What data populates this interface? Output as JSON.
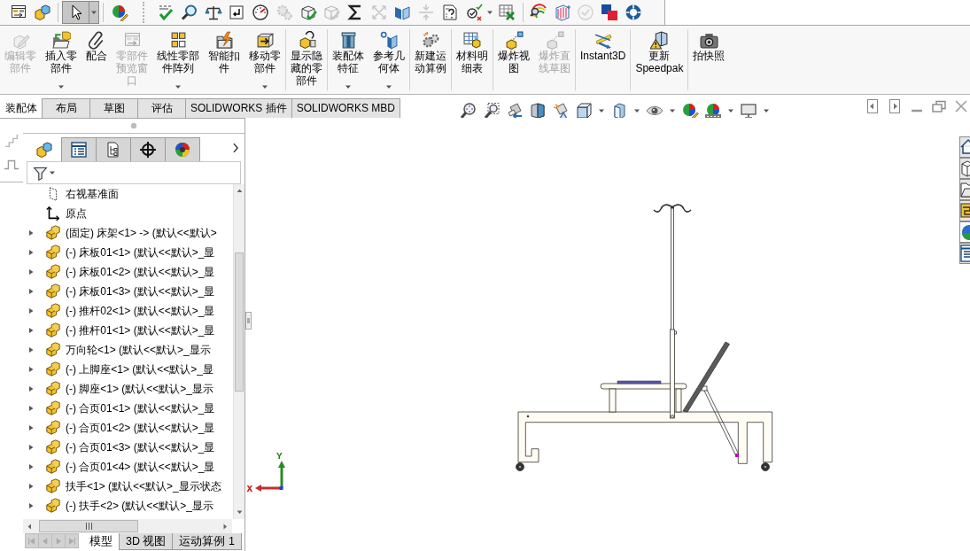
{
  "quick_access_toolbar": [
    {
      "kind": "button",
      "disabled": false
    },
    {
      "kind": "button",
      "disabled": false
    },
    {
      "kind": "separator"
    },
    {
      "kind": "split",
      "pressed": true
    },
    {
      "kind": "separator"
    },
    {
      "kind": "button",
      "disabled": false
    },
    {
      "kind": "grip"
    },
    {
      "kind": "button",
      "disabled": false
    },
    {
      "kind": "button",
      "disabled": false
    },
    {
      "kind": "button",
      "disabled": false
    },
    {
      "kind": "button",
      "disabled": false
    },
    {
      "kind": "button",
      "disabled": false
    },
    {
      "kind": "button",
      "disabled": true
    },
    {
      "kind": "button",
      "disabled": false
    },
    {
      "kind": "button",
      "disabled": true
    },
    {
      "kind": "button",
      "disabled": false
    },
    {
      "kind": "button",
      "disabled": true
    },
    {
      "kind": "button",
      "disabled": false
    },
    {
      "kind": "button",
      "disabled": true
    },
    {
      "kind": "button",
      "disabled": false
    },
    {
      "kind": "split",
      "pressed": false
    },
    {
      "kind": "button",
      "disabled": false
    },
    {
      "kind": "separator"
    },
    {
      "kind": "button",
      "disabled": false
    },
    {
      "kind": "button",
      "disabled": false
    },
    {
      "kind": "button",
      "disabled": true
    },
    {
      "kind": "button",
      "disabled": false
    },
    {
      "kind": "button",
      "disabled": false
    }
  ],
  "command_manager": [
    {
      "kind": "button",
      "label_lines": [
        "编辑零",
        "部件"
      ],
      "disabled": true,
      "dropdown": false
    },
    {
      "kind": "button",
      "label_lines": [
        "插入零",
        "部件"
      ],
      "disabled": false,
      "dropdown": true
    },
    {
      "kind": "button",
      "label_lines": [
        "配合"
      ],
      "disabled": false,
      "dropdown": false
    },
    {
      "kind": "button",
      "label_lines": [
        "零部件",
        "预览窗",
        "口"
      ],
      "disabled": true,
      "dropdown": false
    },
    {
      "kind": "button",
      "label_lines": [
        "线性零部",
        "件阵列"
      ],
      "disabled": false,
      "dropdown": true
    },
    {
      "kind": "button",
      "label_lines": [
        "智能扣",
        "件"
      ],
      "disabled": false,
      "dropdown": false
    },
    {
      "kind": "button",
      "label_lines": [
        "移动零",
        "部件"
      ],
      "disabled": false,
      "dropdown": true
    },
    {
      "kind": "separator"
    },
    {
      "kind": "button",
      "label_lines": [
        "显示隐",
        "藏的零",
        "部件"
      ],
      "disabled": false,
      "dropdown": false
    },
    {
      "kind": "separator"
    },
    {
      "kind": "button",
      "label_lines": [
        "装配体",
        "特征"
      ],
      "disabled": false,
      "dropdown": true
    },
    {
      "kind": "button",
      "label_lines": [
        "参考几",
        "何体"
      ],
      "disabled": false,
      "dropdown": true
    },
    {
      "kind": "separator"
    },
    {
      "kind": "button",
      "label_lines": [
        "新建运",
        "动算例"
      ],
      "disabled": false,
      "dropdown": false
    },
    {
      "kind": "separator"
    },
    {
      "kind": "button",
      "label_lines": [
        "材料明",
        "细表"
      ],
      "disabled": false,
      "dropdown": false
    },
    {
      "kind": "separator"
    },
    {
      "kind": "button",
      "label_lines": [
        "爆炸视",
        "图"
      ],
      "disabled": false,
      "dropdown": false
    },
    {
      "kind": "button",
      "label_lines": [
        "爆炸直",
        "线草图"
      ],
      "disabled": true,
      "dropdown": false
    },
    {
      "kind": "separator"
    },
    {
      "kind": "button",
      "label_lines": [
        "Instant3D"
      ],
      "disabled": false,
      "dropdown": false
    },
    {
      "kind": "separator"
    },
    {
      "kind": "button",
      "label_lines": [
        "更新",
        "Speedpak"
      ],
      "disabled": false,
      "dropdown": false
    },
    {
      "kind": "separator"
    },
    {
      "kind": "button",
      "label_lines": [
        "拍快照"
      ],
      "disabled": false,
      "dropdown": false
    }
  ],
  "command_tabs": [
    {
      "label": "装配体",
      "selected": true
    },
    {
      "label": "布局",
      "selected": false
    },
    {
      "label": "草图",
      "selected": false
    },
    {
      "label": "评估",
      "selected": false
    },
    {
      "label": "SOLIDWORKS 插件",
      "selected": false
    },
    {
      "label": "SOLIDWORKS MBD",
      "selected": false
    }
  ],
  "view_toolbar": [
    {
      "dropdown": false
    },
    {
      "dropdown": false
    },
    {
      "dropdown": false
    },
    {
      "dropdown": false
    },
    {
      "dropdown": false
    },
    {
      "dropdown": true
    },
    {
      "dropdown": true
    },
    {
      "dropdown": true
    },
    {
      "dropdown": false
    },
    {
      "dropdown": true
    },
    {
      "dropdown": true
    }
  ],
  "feature_manager": {
    "tabs": [
      {
        "selected": true
      },
      {
        "selected": false
      },
      {
        "selected": false
      },
      {
        "selected": false
      },
      {
        "selected": false
      }
    ],
    "tree": [
      {
        "kind": "plane",
        "label": "右视基准面"
      },
      {
        "kind": "origin",
        "label": "原点"
      },
      {
        "kind": "component",
        "label": "(固定) 床架<1> -> (默认<<默认>",
        "expanded": false
      },
      {
        "kind": "component",
        "label": "(-) 床板01<1> (默认<<默认>_显",
        "expanded": false
      },
      {
        "kind": "component",
        "label": "(-) 床板01<2> (默认<<默认>_显",
        "expanded": false
      },
      {
        "kind": "component",
        "label": "(-) 床板01<3> (默认<<默认>_显",
        "expanded": false
      },
      {
        "kind": "component",
        "label": "(-) 推杆02<1> (默认<<默认>_显",
        "expanded": false
      },
      {
        "kind": "component",
        "label": "(-) 推杆01<1> (默认<<默认>_显",
        "expanded": false
      },
      {
        "kind": "component",
        "label": "万向轮<1> (默认<<默认>_显示",
        "expanded": false
      },
      {
        "kind": "component",
        "label": "(-) 上脚座<1> (默认<<默认>_显",
        "expanded": false
      },
      {
        "kind": "component",
        "label": "(-) 脚座<1> (默认<<默认>_显示",
        "expanded": false
      },
      {
        "kind": "component",
        "label": "(-) 合页01<1> (默认<<默认>_显",
        "expanded": false
      },
      {
        "kind": "component",
        "label": "(-) 合页01<2> (默认<<默认>_显",
        "expanded": false
      },
      {
        "kind": "component",
        "label": "(-) 合页01<3> (默认<<默认>_显",
        "expanded": false
      },
      {
        "kind": "component",
        "label": "(-) 合页01<4> (默认<<默认>_显",
        "expanded": false
      },
      {
        "kind": "component",
        "label": "扶手<1> (默认<<默认>_显示状态",
        "expanded": false
      },
      {
        "kind": "component",
        "label": "(-) 扶手<2> (默认<<默认>_显示",
        "expanded": false
      }
    ],
    "tab_scroll_buttons": [
      {
        "disabled": true
      },
      {
        "disabled": true
      },
      {
        "disabled": true
      },
      {
        "disabled": true
      }
    ],
    "bottom_tabs": [
      {
        "label": "模型",
        "selected": true
      },
      {
        "label": "3D 视图",
        "selected": false
      },
      {
        "label": "运动算例 1",
        "selected": false
      }
    ]
  },
  "graphics": {
    "triad": [
      {
        "label": "X",
        "color": "#d40000"
      },
      {
        "label": "Y",
        "color": "#1f7a1f"
      }
    ]
  }
}
